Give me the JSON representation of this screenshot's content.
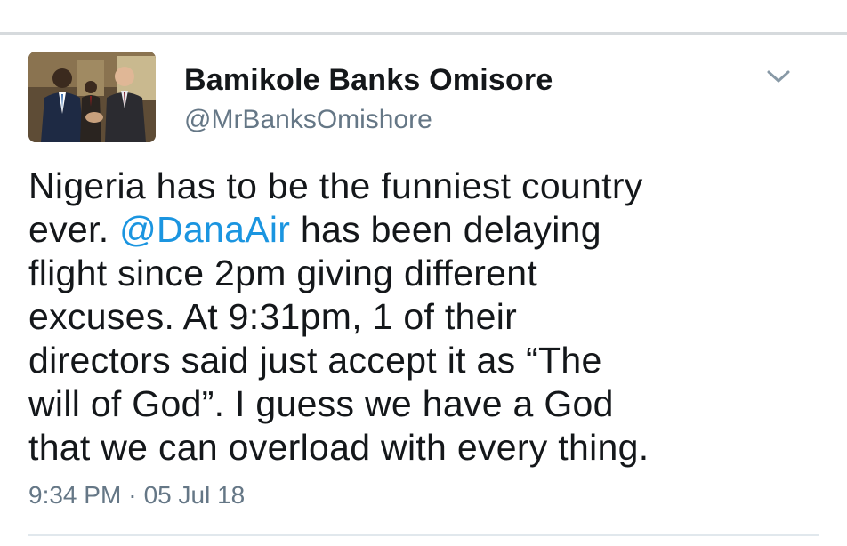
{
  "tweet": {
    "author": {
      "display_name": "Bamikole Banks Omisore",
      "handle": "@MrBanksOmishore",
      "avatar_icon": "avatar-photo"
    },
    "menu_icon": "chevron-down-icon",
    "text": {
      "part1": "Nigeria has to be the funniest country\never. ",
      "mention": "@DanaAir",
      "part2": " has been delaying\nflight since 2pm giving different\nexcuses. At 9:31pm, 1 of their\ndirectors said just accept it as “The\nwill of God”. I guess we have a God\nthat we can overload with every thing."
    },
    "time": "9:34 PM",
    "separator": "·",
    "date": "05 Jul 18"
  },
  "colors": {
    "text": "#14171a",
    "secondary": "#657786",
    "link": "#1b95e0",
    "divider": "#e1e8ed"
  }
}
